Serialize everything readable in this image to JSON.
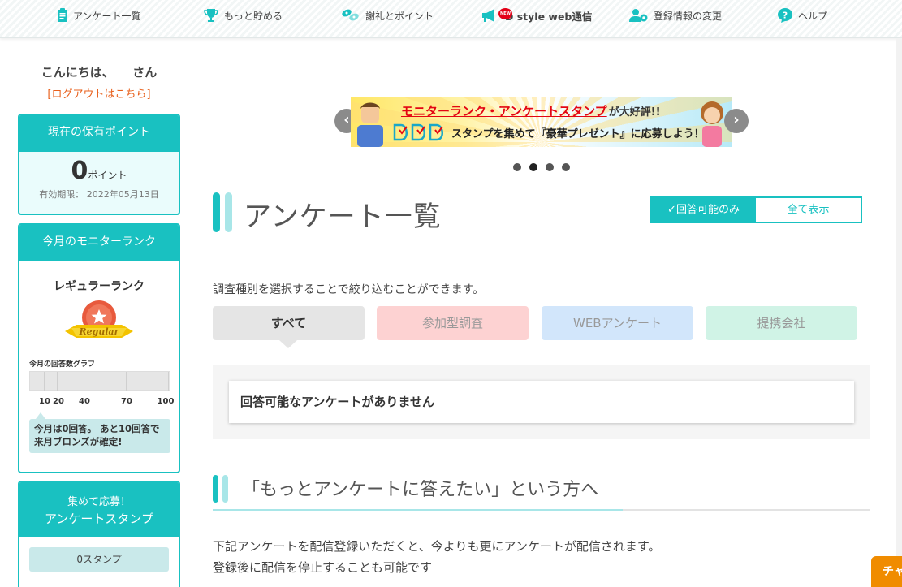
{
  "nav": {
    "items": [
      {
        "label": "アンケート一覧",
        "icon": "clipboard-icon"
      },
      {
        "label": "もっと貯める",
        "icon": "trophy-icon"
      },
      {
        "label": "謝礼とポイント",
        "icon": "gift-icon"
      },
      {
        "label": "D style web通信",
        "icon": "megaphone-icon",
        "badge": "NEW"
      },
      {
        "label": "登録情報の変更",
        "icon": "user-gear-icon"
      },
      {
        "label": "ヘルプ",
        "icon": "help-icon"
      }
    ]
  },
  "sidebar": {
    "greeting": "こんにちは、　　さん",
    "logout": "[ログアウトはこちら]",
    "points": {
      "title": "現在の保有ポイント",
      "value": "0",
      "unit": "ポイント",
      "expiry": "有効期限： 2022年05月13日"
    },
    "rank": {
      "title": "今月のモニターランク",
      "rank_name": "レギュラーランク",
      "medal_text": "Regular",
      "graph_label": "今月の回答数グラフ",
      "ticks": [
        "10",
        "20",
        "40",
        "70",
        "100"
      ],
      "message": "今月は0回答。 あと10回答で来月ブロンズが確定!"
    },
    "stamp": {
      "title_line1": "集めて応募！",
      "title_line2": "アンケートスタンプ",
      "count": "0スタンプ"
    }
  },
  "banner": {
    "headline": "モニターランク・アンケートスタンプ",
    "headline_suffix": "が大好評!!",
    "subline": "スタンプを集めて『豪華プレゼント』に応募しよう！",
    "prev": "‹",
    "next": "›",
    "active_dot": 1
  },
  "main": {
    "title": "アンケート一覧",
    "toggle_on": "✓回答可能のみ",
    "toggle_off": "全て表示",
    "filter_desc": "調査種別を選択することで絞り込むことができます。",
    "tabs": [
      "すべて",
      "参加型調査",
      "WEBアンケート",
      "提携会社"
    ],
    "empty_message": "回答可能なアンケートがありません",
    "section_title": "「もっとアンケートに答えたい」という方へ",
    "body_line1": "下記アンケートを配信登録いただくと、今よりも更にアンケートが配信されます。",
    "body_line2": "登録後に配信を停止することも可能です"
  },
  "chat_label": "チャット",
  "colors": {
    "accent": "#19c1c1",
    "logout": "#e8601c",
    "chat": "#f08c00"
  }
}
